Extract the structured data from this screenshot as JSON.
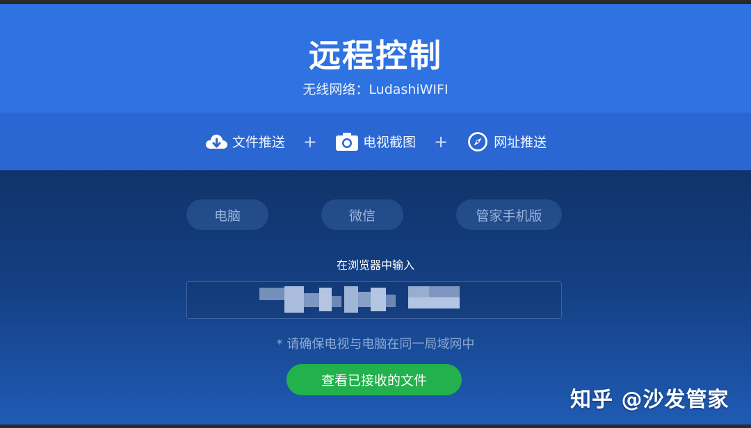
{
  "header": {
    "title": "远程控制",
    "network": "无线网络：LudashiWIFI"
  },
  "features": [
    {
      "label": "文件推送",
      "icon": "cloud-download-icon"
    },
    {
      "label": "电视截图",
      "icon": "camera-icon"
    },
    {
      "label": "网址推送",
      "icon": "compass-icon"
    }
  ],
  "features_separator": "+",
  "tabs": [
    {
      "label": "电脑"
    },
    {
      "label": "微信"
    },
    {
      "label": "管家手机版"
    }
  ],
  "instruction": "在浏览器中输入",
  "note": "* 请确保电视与电脑在同一局域网中",
  "action_button": "查看已接收的文件",
  "watermark": "知乎 @沙发管家",
  "colors": {
    "header_blue": "#2f72e2",
    "feature_bar_blue": "#2a67d2",
    "main_navy": "#143f82",
    "button_green": "#22b14c"
  }
}
